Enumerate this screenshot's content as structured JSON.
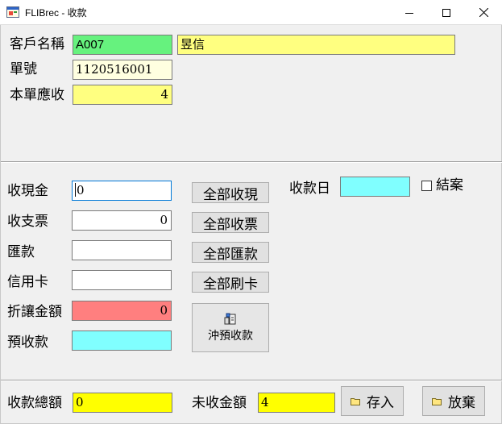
{
  "window": {
    "title": "FLIBrec - 收款",
    "icon": "app-icon",
    "controls": [
      "minimize-icon",
      "maximize-icon",
      "close-icon"
    ]
  },
  "colors": {
    "green": "#66f27e",
    "yellow_light": "#ffff80",
    "cream": "#ffffe0",
    "cyan": "#80ffff",
    "red": "#ff7f7f",
    "yellow": "#ffff00",
    "focus": "#0078d7"
  },
  "header": {
    "customer_label": "客戶名稱",
    "customer_code": "A007",
    "customer_name": "昱信",
    "order_no_label": "單號",
    "order_no": "1120516001",
    "receivable_label": "本單應收",
    "receivable": "4"
  },
  "payment": {
    "cash_label": "收現金",
    "cash_value": "0",
    "check_label": "收支票",
    "check_value": "0",
    "remit_label": "匯款",
    "remit_value": "",
    "card_label": "信用卡",
    "card_value": "",
    "discount_label": "折讓金額",
    "discount_value": "0",
    "prepaid_label": "預收款",
    "prepaid_value": ""
  },
  "buttons": {
    "all_cash": "全部收現",
    "all_check": "全部收票",
    "all_remit": "全部匯款",
    "all_card": "全部刷卡",
    "offset_prepaid": "沖預收款",
    "save": "存入",
    "cancel": "放棄"
  },
  "receipt": {
    "date_label": "收款日",
    "date_value": "",
    "close_label": "結案",
    "close_checked": false
  },
  "footer": {
    "total_label": "收款總額",
    "total_value": "0",
    "unpaid_label": "未收金額",
    "unpaid_value": "4"
  }
}
